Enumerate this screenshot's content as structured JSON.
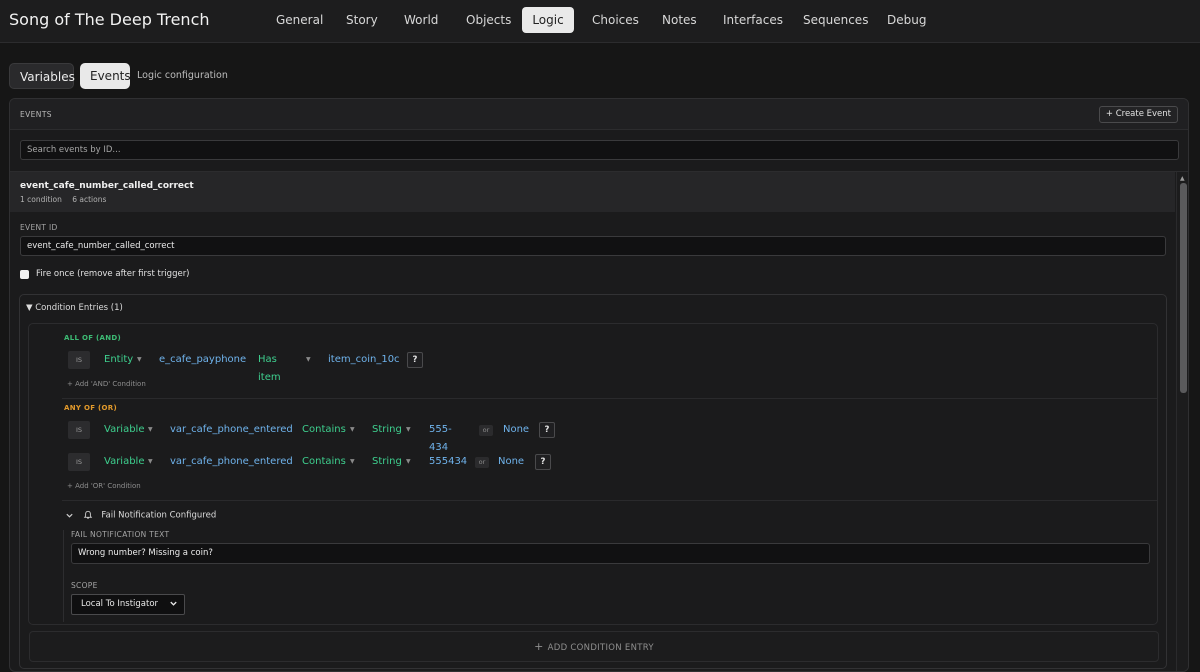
{
  "app": {
    "title": "Song of The Deep Trench"
  },
  "nav": {
    "tabs": [
      "General",
      "Story",
      "World",
      "Objects",
      "Logic",
      "Choices",
      "Notes",
      "Interfaces",
      "Sequences",
      "Debug"
    ],
    "active": "Logic"
  },
  "subtabs": {
    "variables": "Variables",
    "events": "Events",
    "active": "Events",
    "caption": "Logic configuration"
  },
  "events_panel": {
    "title": "EVENTS",
    "create_label": "+ Create Event",
    "search_placeholder": "Search events by ID...",
    "event": {
      "name": "event_cafe_number_called_correct",
      "conditions_count": "1 condition",
      "actions_count": "6 actions",
      "id_label": "EVENT ID",
      "id_value": "event_cafe_number_called_correct",
      "fire_once_label": "Fire once (remove after first trigger)",
      "fire_once_checked": false,
      "conditions": {
        "title": "▼ Condition Entries (1)",
        "and_label": "ALL OF (AND)",
        "and_rows": [
          {
            "is": "IS",
            "type": "Entity",
            "target": "e_cafe_payphone",
            "op": "Has item",
            "value": "item_coin_10c",
            "help": "?"
          }
        ],
        "add_and": "+ Add 'AND' Condition",
        "or_label": "ANY OF (OR)",
        "or_rows": [
          {
            "is": "IS",
            "type": "Variable",
            "target": "var_cafe_phone_entered",
            "op": "Contains",
            "value_type": "String",
            "value": "555-434",
            "or": "or",
            "alt": "None",
            "help": "?"
          },
          {
            "is": "IS",
            "type": "Variable",
            "target": "var_cafe_phone_entered",
            "op": "Contains",
            "value_type": "String",
            "value": "555434",
            "or": "or",
            "alt": "None",
            "help": "?"
          }
        ],
        "add_or": "+ Add 'OR' Condition",
        "fail": {
          "header": "Fail Notification Configured",
          "text_label": "FAIL NOTIFICATION TEXT",
          "text_value": "Wrong number? Missing a coin?",
          "scope_label": "SCOPE",
          "scope_value": "Local To Instigator"
        },
        "add_entry": "ADD CONDITION ENTRY"
      }
    }
  },
  "colors": {
    "and": "#3dbb74",
    "or": "#e39a2b",
    "token_green": "#3ecf8e",
    "token_blue": "#6fb3ec"
  },
  "icons": {
    "bell": "bell-icon",
    "chevron_down": "chevron-down-icon",
    "plus": "plus-icon"
  }
}
